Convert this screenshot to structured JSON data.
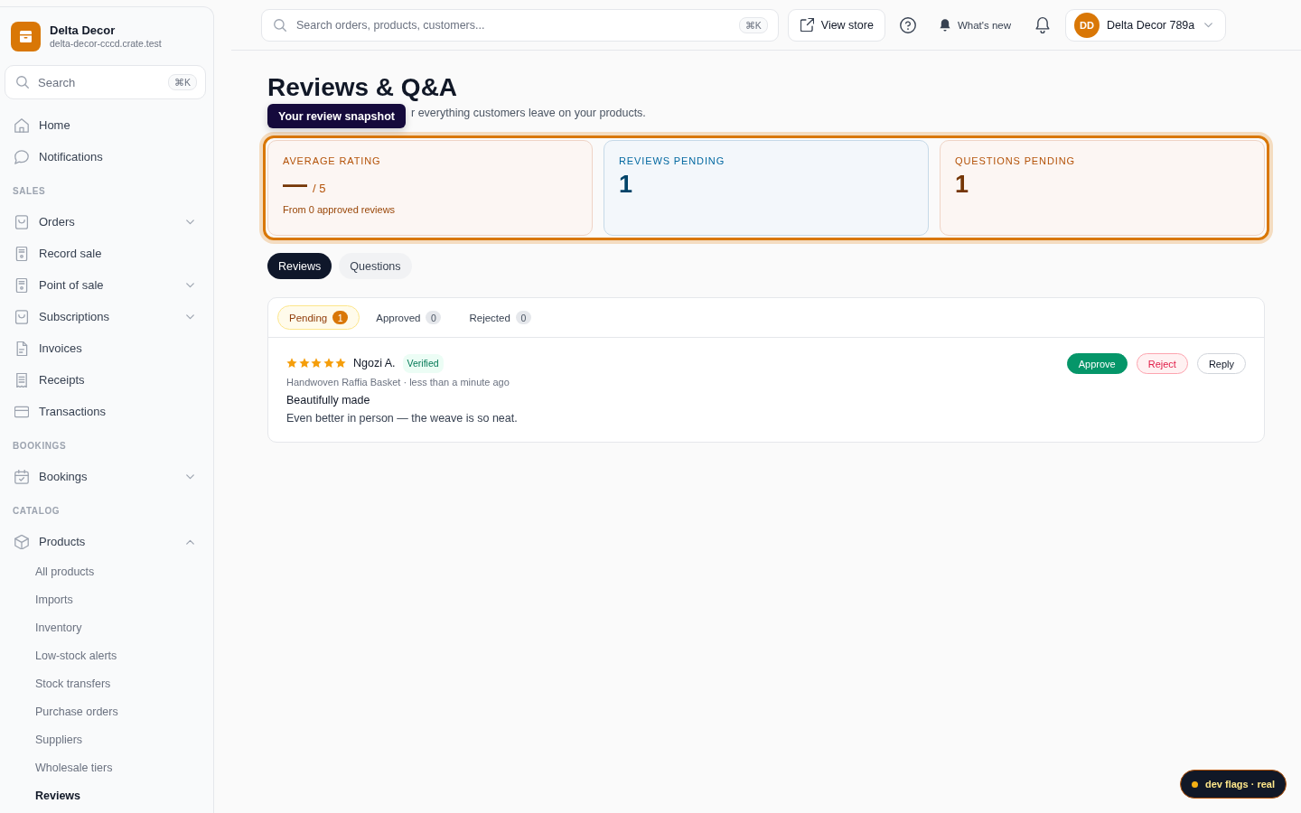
{
  "sidebar": {
    "brand": {
      "name": "Delta Decor",
      "domain": "delta-decor-cccd.crate.test"
    },
    "search": {
      "placeholder": "Search",
      "shortcut": "⌘K"
    },
    "sections": [
      {
        "items": [
          {
            "label": "Home",
            "kind": "link"
          },
          {
            "label": "Notifications",
            "kind": "link"
          }
        ]
      },
      {
        "label": "SALES",
        "items": [
          {
            "label": "Orders",
            "kind": "group",
            "expanded": false
          },
          {
            "label": "Record sale",
            "kind": "link"
          },
          {
            "label": "Point of sale",
            "kind": "group",
            "expanded": false
          },
          {
            "label": "Subscriptions",
            "kind": "group",
            "expanded": false
          },
          {
            "label": "Invoices",
            "kind": "link"
          },
          {
            "label": "Receipts",
            "kind": "link"
          },
          {
            "label": "Transactions",
            "kind": "link"
          }
        ]
      },
      {
        "label": "BOOKINGS",
        "items": [
          {
            "label": "Bookings",
            "kind": "group",
            "expanded": false
          }
        ]
      },
      {
        "label": "CATALOG",
        "items": [
          {
            "label": "Products",
            "kind": "group",
            "expanded": true,
            "children": [
              {
                "label": "All products",
                "selected": false
              },
              {
                "label": "Imports",
                "selected": false
              },
              {
                "label": "Inventory",
                "selected": false
              },
              {
                "label": "Low-stock alerts",
                "selected": false
              },
              {
                "label": "Stock transfers",
                "selected": false
              },
              {
                "label": "Purchase orders",
                "selected": false
              },
              {
                "label": "Suppliers",
                "selected": false
              },
              {
                "label": "Wholesale tiers",
                "selected": false
              },
              {
                "label": "Reviews",
                "selected": true
              }
            ]
          }
        ]
      }
    ]
  },
  "topbar": {
    "search": {
      "placeholder": "Search orders, products, customers...",
      "shortcut": "⌘K"
    },
    "view_store": "View store",
    "whats_new": "What's new",
    "account": {
      "initials": "DD",
      "name": "Delta Decor 789a"
    }
  },
  "page": {
    "title": "Reviews & Q&A",
    "subtitle": "r everything customers leave on your products.",
    "tour_tooltip": "Your review snapshot"
  },
  "stats": {
    "highlighted": true,
    "cards": [
      {
        "label": "AVERAGE RATING",
        "value": "—",
        "suffix": "/ 5",
        "note": "From 0 approved reviews",
        "color": "#b45309"
      },
      {
        "label": "REVIEWS PENDING",
        "value": "1",
        "color": "#0369a1"
      },
      {
        "label": "QUESTIONS PENDING",
        "value": "1",
        "color": "#b45309"
      }
    ]
  },
  "tabs": [
    {
      "label": "Reviews",
      "selected": true
    },
    {
      "label": "Questions",
      "selected": false
    }
  ],
  "filters": [
    {
      "label": "Pending",
      "count": "1",
      "selected": true
    },
    {
      "label": "Approved",
      "count": "0",
      "selected": false
    },
    {
      "label": "Rejected",
      "count": "0",
      "selected": false
    }
  ],
  "reviews": [
    {
      "stars": 5,
      "author": "Ngozi A.",
      "badge": "Verified",
      "meta": "Handwoven Raffia Basket · less than a minute ago",
      "title": "Beautifully made",
      "body": "Even better in person — the weave is so neat.",
      "actions": [
        {
          "label": "Approve",
          "kind": "approve"
        },
        {
          "label": "Reject",
          "kind": "reject"
        },
        {
          "label": "Reply",
          "kind": "reply"
        }
      ]
    }
  ],
  "dev_badge": {
    "label": "dev flags · real"
  }
}
